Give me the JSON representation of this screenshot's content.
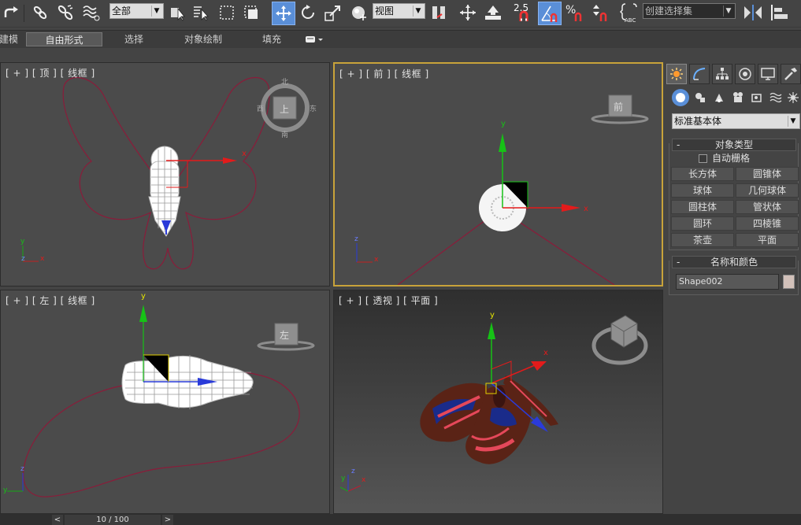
{
  "toolbar": {
    "selection_filter": "全部",
    "ref_coord": "视图",
    "snap_value": "2.5",
    "named_selection": "创建选择集",
    "icons": [
      "redo-icon",
      "link-icon",
      "unlink-icon",
      "bind-spacewarp-icon",
      "select-object-icon",
      "select-by-name-icon",
      "rect-region-icon",
      "window-crossing-icon",
      "move-icon",
      "rotate-icon",
      "scale-icon",
      "pivot-center-icon",
      "manipulate-icon",
      "keyboard-shortcut-icon",
      "snap-icon",
      "angle-snap-icon",
      "percent-snap-icon",
      "spinner-snap-icon",
      "edit-named-selection-icon",
      "mirror-icon",
      "align-icon"
    ]
  },
  "ribbon": {
    "tabs": [
      "建模",
      "自由形式",
      "选择",
      "对象绘制",
      "填充"
    ],
    "active_tab": "自由形式"
  },
  "viewports": {
    "top": {
      "label": "[ + ] [ 顶 ] [ 线框 ]",
      "cube_center": "上",
      "compass_n": "北",
      "compass_s": "南",
      "compass_e": "东",
      "compass_w": "西"
    },
    "front": {
      "label": "[ + ] [ 前 ] [ 线框 ]",
      "cube_face": "前"
    },
    "left": {
      "label": "[ + ] [ 左 ] [ 线框 ]",
      "cube_face": "左"
    },
    "perspective": {
      "label": "[ + ] [ 透视 ] [ 平面 ]"
    },
    "axis_x": "x",
    "axis_y": "y",
    "axis_z": "z",
    "colors": {
      "curve": "#8a1c3a",
      "active_border": "#c8a33a",
      "gizmo_x": "#e31b1b",
      "gizmo_y": "#16c216",
      "gizmo_z": "#2a3bd9"
    }
  },
  "command_panel": {
    "tabs": [
      "create-tab-icon",
      "modify-tab-icon",
      "hierarchy-tab-icon",
      "motion-tab-icon",
      "display-tab-icon",
      "utilities-tab-icon"
    ],
    "subcategories": [
      "geometry-icon",
      "shapes-icon",
      "lights-icon",
      "cameras-icon",
      "helpers-icon",
      "spacewarps-icon",
      "systems-icon"
    ],
    "category_dropdown": "标准基本体",
    "object_type": {
      "header": "对象类型",
      "autogrid_label": "自动栅格",
      "autogrid_checked": false,
      "buttons": [
        "长方体",
        "圆锥体",
        "球体",
        "几何球体",
        "圆柱体",
        "管状体",
        "圆环",
        "四棱锥",
        "茶壶",
        "平面"
      ]
    },
    "name_color": {
      "header": "名称和颜色",
      "name_value": "Shape002",
      "swatch_color": "#d2c1ba"
    },
    "rollout_minus": "-"
  },
  "timeline": {
    "prev": "<",
    "frame": "10 / 100",
    "next": ">"
  }
}
